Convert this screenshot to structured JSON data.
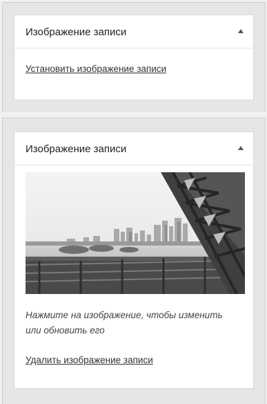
{
  "set_box": {
    "title": "Изображение записи",
    "set_link": "Установить изображение записи"
  },
  "featured_box": {
    "title": "Изображение записи",
    "image_alt": "Изображение записи",
    "hint": "Нажмите на изображение, чтобы изменить или обновить его",
    "remove_link": "Удалить изображение записи"
  },
  "icons": {
    "collapse": "triangle-up-icon"
  }
}
